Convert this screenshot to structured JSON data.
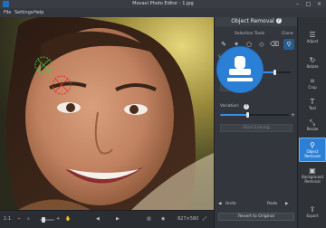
{
  "window": {
    "title": "Movavi Photo Editor - 1.jpg"
  },
  "menu": [
    "File",
    "Settings",
    "Help"
  ],
  "panel": {
    "title": "Object Removal",
    "help_badge": "?",
    "selection_tools_label": "Selection Tools",
    "clone_label": "Clone",
    "stamp_label": "Stam",
    "variation_label": "Variation:",
    "variation_help": "?",
    "start_erasing_label": "Start Erasing",
    "undo_label": "Undo",
    "redo_label": "Redo",
    "revert_label": "Revert to Original",
    "variation_value": 0.45,
    "brush_size_value": 0.75
  },
  "toolbar": {
    "items": [
      {
        "label": "Adjust",
        "icon": "adjust-icon"
      },
      {
        "label": "Rotate",
        "icon": "rotate-icon"
      },
      {
        "label": "Crop",
        "icon": "crop-icon"
      },
      {
        "label": "Text",
        "icon": "text-icon"
      },
      {
        "label": "Resize",
        "icon": "resize-icon"
      },
      {
        "label": "Object Removal",
        "icon": "object-removal-icon"
      },
      {
        "label": "Background Removal",
        "icon": "background-removal-icon"
      },
      {
        "label": "Export",
        "icon": "export-icon"
      }
    ]
  },
  "status": {
    "zoom_ratio": "1:1",
    "dimensions": "827×580"
  },
  "colors": {
    "accent": "#2b7fd4",
    "clone_source": "#3bd13b",
    "clone_target": "#e02b2b"
  }
}
